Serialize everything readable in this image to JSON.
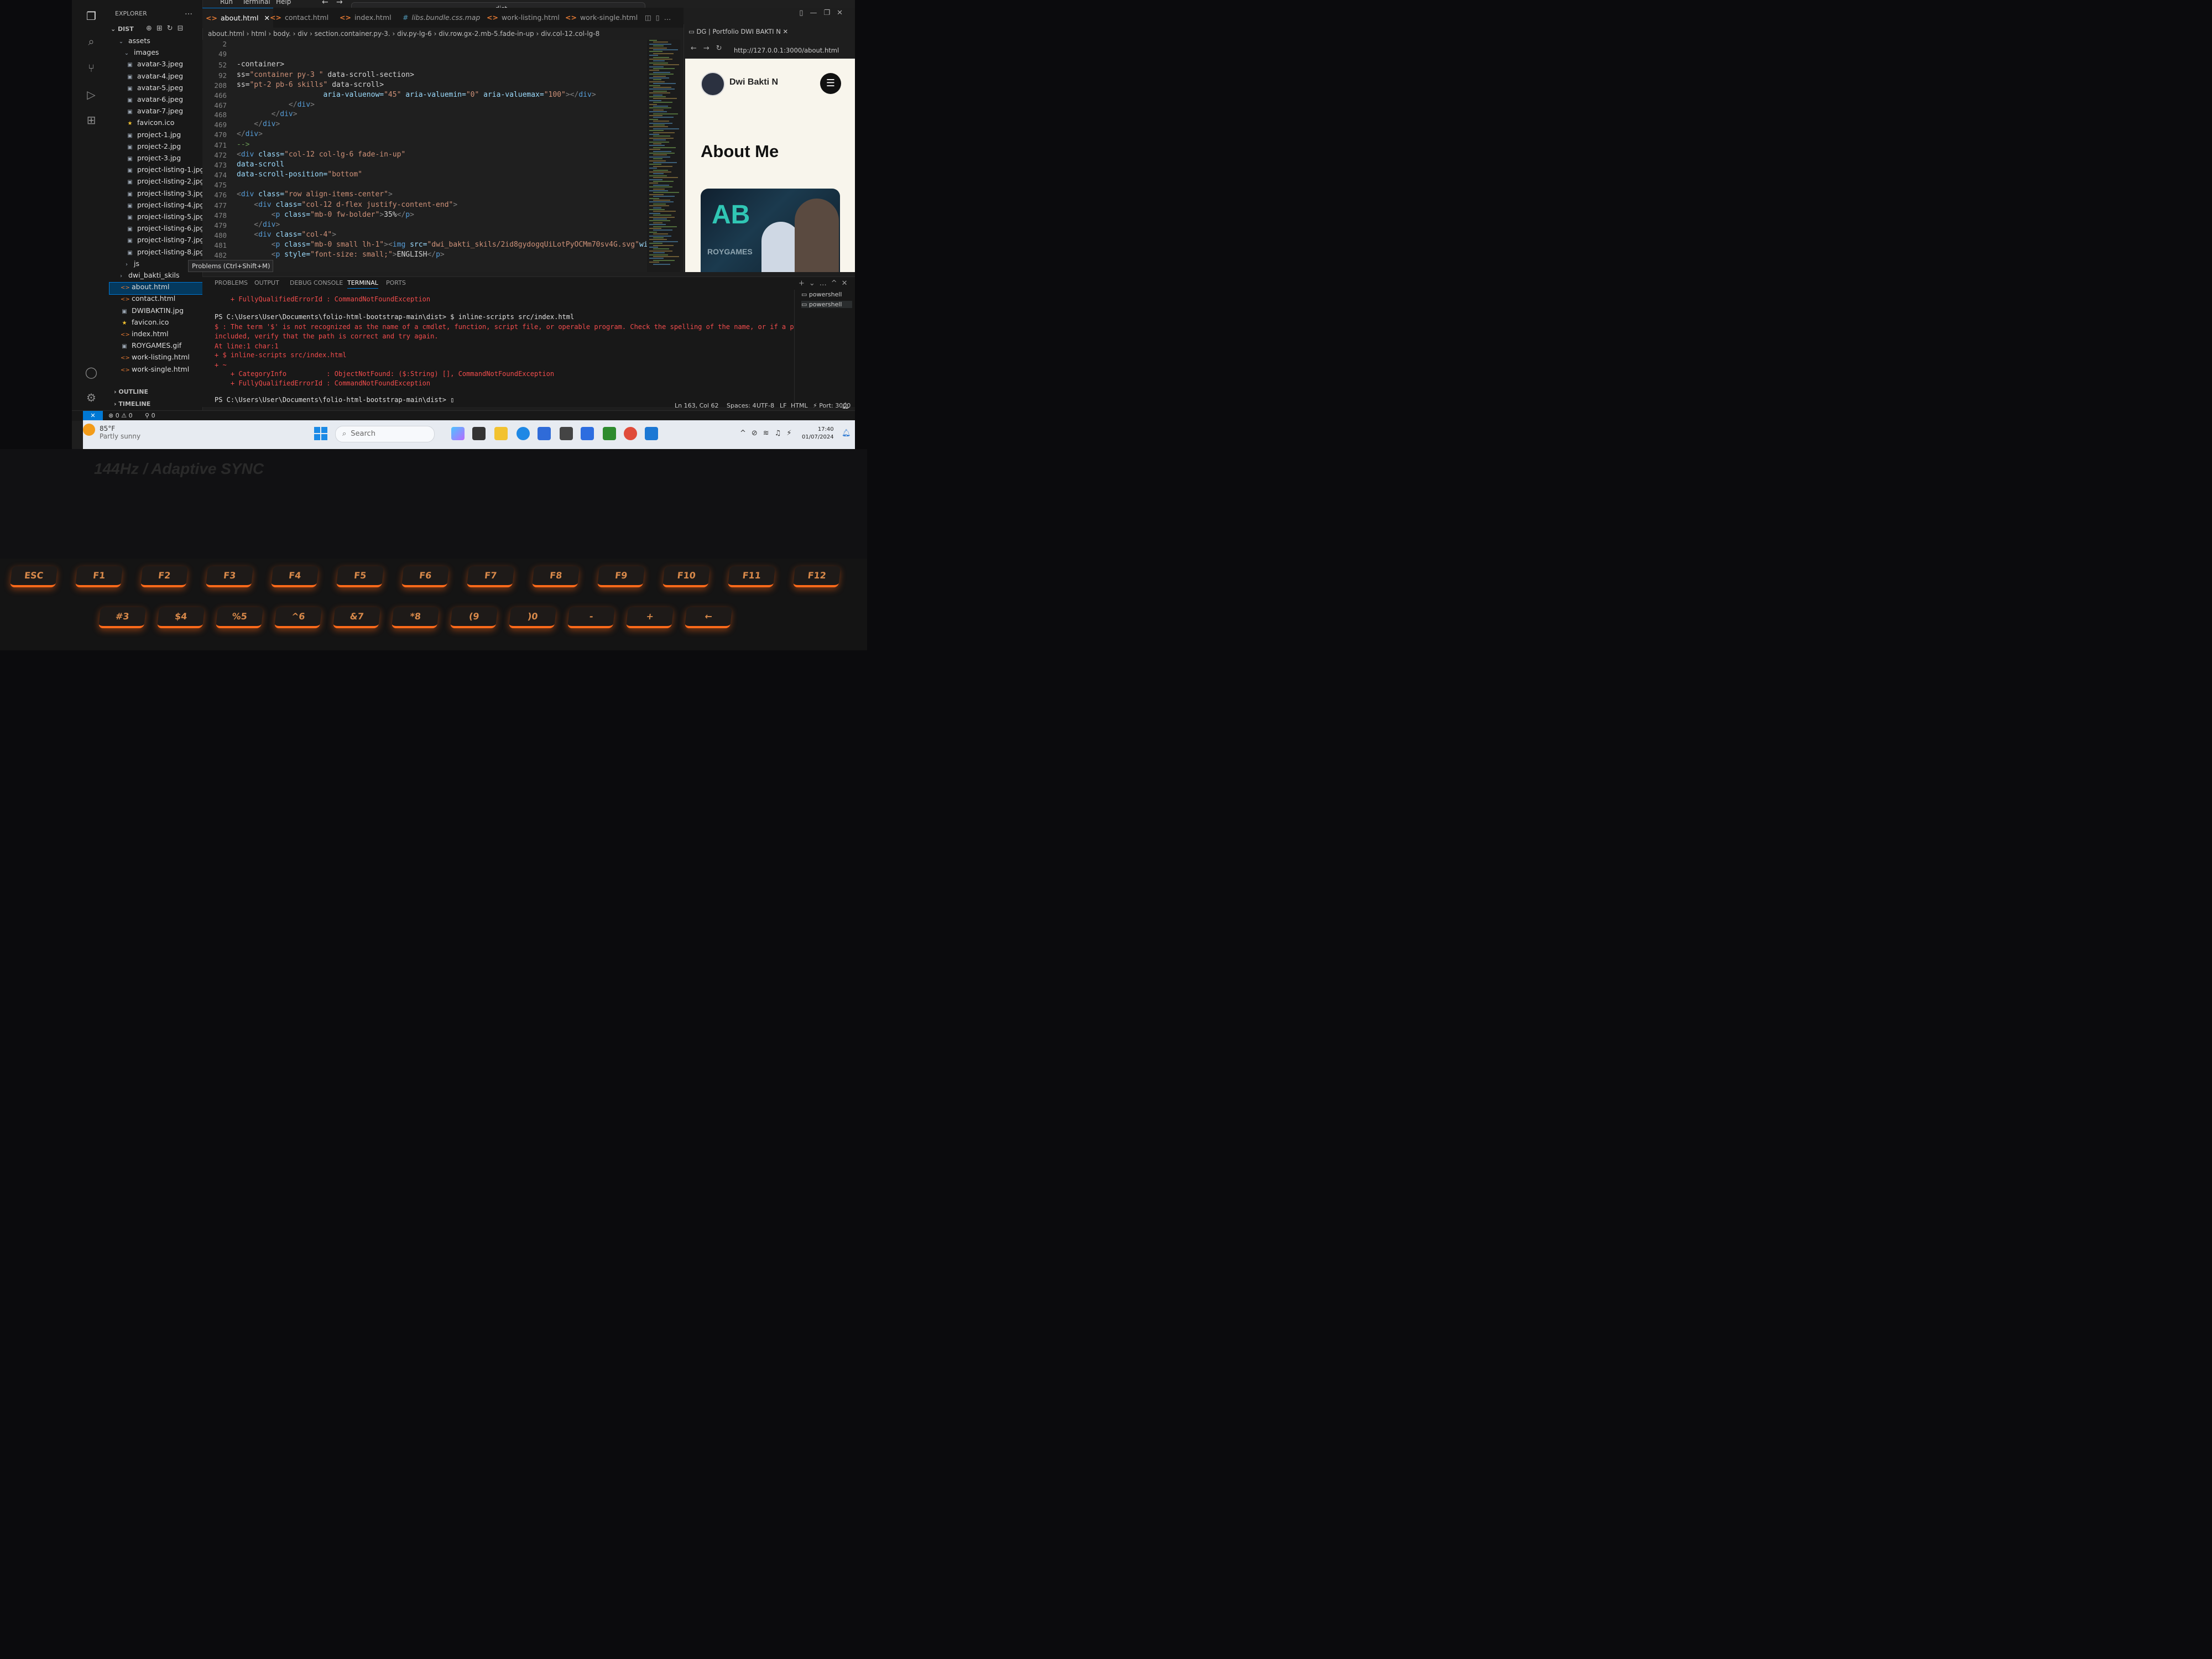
{
  "menu": {
    "items": [
      "Run",
      "Terminal",
      "Help"
    ]
  },
  "command_center": {
    "label": "dist"
  },
  "explorer": {
    "title": "EXPLORER",
    "root": "DIST",
    "items": [
      {
        "label": "assets",
        "kind": "folder-open"
      },
      {
        "label": "images",
        "kind": "folder-open"
      },
      {
        "label": "avatar-3.jpeg",
        "kind": "image"
      },
      {
        "label": "avatar-4.jpeg",
        "kind": "image"
      },
      {
        "label": "avatar-5.jpeg",
        "kind": "image"
      },
      {
        "label": "avatar-6.jpeg",
        "kind": "image"
      },
      {
        "label": "avatar-7.jpeg",
        "kind": "image"
      },
      {
        "label": "favicon.ico",
        "kind": "star"
      },
      {
        "label": "project-1.jpg",
        "kind": "image"
      },
      {
        "label": "project-2.jpg",
        "kind": "image"
      },
      {
        "label": "project-3.jpg",
        "kind": "image"
      },
      {
        "label": "project-listing-1.jpg",
        "kind": "image"
      },
      {
        "label": "project-listing-2.jpg",
        "kind": "image"
      },
      {
        "label": "project-listing-3.jpg",
        "kind": "image"
      },
      {
        "label": "project-listing-4.jpg",
        "kind": "image"
      },
      {
        "label": "project-listing-5.jpg",
        "kind": "image"
      },
      {
        "label": "project-listing-6.jpg",
        "kind": "image"
      },
      {
        "label": "project-listing-7.jpg",
        "kind": "image"
      },
      {
        "label": "project-listing-8.jpg",
        "kind": "image"
      },
      {
        "label": "js",
        "kind": "folder"
      },
      {
        "label": "dwi_bakti_skils",
        "kind": "folder"
      },
      {
        "label": "about.html",
        "kind": "html",
        "selected": true
      },
      {
        "label": "contact.html",
        "kind": "html"
      },
      {
        "label": "DWIBAKTIN.jpg",
        "kind": "image"
      },
      {
        "label": "favicon.ico",
        "kind": "star"
      },
      {
        "label": "index.html",
        "kind": "html"
      },
      {
        "label": "ROYGAMES.gif",
        "kind": "image"
      },
      {
        "label": "work-listing.html",
        "kind": "html"
      },
      {
        "label": "work-single.html",
        "kind": "html"
      }
    ],
    "outline": "OUTLINE",
    "timeline": "TIMELINE"
  },
  "tabs": [
    {
      "label": "about.html",
      "active": true
    },
    {
      "label": "contact.html"
    },
    {
      "label": "index.html"
    },
    {
      "label": "libs.bundle.css.map"
    },
    {
      "label": "work-listing.html"
    },
    {
      "label": "work-single.html"
    }
  ],
  "breadcrumb": [
    "about.html",
    "html",
    "body.",
    "div",
    "section.container.py-3.",
    "div.py-lg-6",
    "div.row.gx-2.mb-5.fade-in-up",
    "div.col-12.col-lg-8"
  ],
  "editor": {
    "lines": [
      {
        "n": "2",
        "code": []
      },
      {
        "n": "49",
        "code": []
      },
      {
        "n": "52",
        "code": [
          [
            "tx",
            "-container>"
          ]
        ]
      },
      {
        "n": "92",
        "code": [
          [
            "tx",
            "ss="
          ],
          [
            "sv",
            "\"container py-3 \""
          ],
          [
            "tx",
            " data-scroll-section>"
          ]
        ]
      },
      {
        "n": "208",
        "code": [
          [
            "tx",
            "ss="
          ],
          [
            "sv",
            "\"pt-2 pb-6 skills\""
          ],
          [
            "tx",
            " data-scroll>"
          ]
        ]
      },
      {
        "n": "466",
        "code": [
          [
            "at",
            "                    aria-valuenow="
          ],
          [
            "sv",
            "\"45\""
          ],
          [
            "at",
            " aria-valuemin="
          ],
          [
            "sv",
            "\"0\""
          ],
          [
            "at",
            " aria-valuemax="
          ],
          [
            "sv",
            "\"100\""
          ],
          [
            "tg",
            "></"
          ],
          [
            "tn",
            "div"
          ],
          [
            "tg",
            ">"
          ]
        ]
      },
      {
        "n": "467",
        "code": [
          [
            "tg",
            "            </"
          ],
          [
            "tn",
            "div"
          ],
          [
            "tg",
            ">"
          ]
        ]
      },
      {
        "n": "468",
        "code": [
          [
            "tg",
            "        </"
          ],
          [
            "tn",
            "div"
          ],
          [
            "tg",
            ">"
          ]
        ]
      },
      {
        "n": "469",
        "code": [
          [
            "tg",
            "    </"
          ],
          [
            "tn",
            "div"
          ],
          [
            "tg",
            ">"
          ]
        ]
      },
      {
        "n": "470",
        "code": [
          [
            "tg",
            "</"
          ],
          [
            "tn",
            "div"
          ],
          [
            "tg",
            ">"
          ]
        ]
      },
      {
        "n": "471",
        "code": [
          [
            "cm",
            "-->"
          ]
        ]
      },
      {
        "n": "472",
        "code": [
          [
            "tg",
            "<"
          ],
          [
            "tn",
            "div"
          ],
          [
            "at",
            " class="
          ],
          [
            "sv",
            "\"col-12 col-lg-6 fade-in-up\""
          ]
        ]
      },
      {
        "n": "473",
        "code": [
          [
            "at",
            "data-scroll"
          ]
        ]
      },
      {
        "n": "474",
        "code": [
          [
            "at",
            "data-scroll-position="
          ],
          [
            "sv",
            "\"bottom\""
          ]
        ]
      },
      {
        "n": "475",
        "code": []
      },
      {
        "n": "476",
        "code": [
          [
            "tg",
            "<"
          ],
          [
            "tn",
            "div"
          ],
          [
            "at",
            " class="
          ],
          [
            "sv",
            "\"row align-items-center\""
          ],
          [
            "tg",
            ">"
          ]
        ]
      },
      {
        "n": "477",
        "code": [
          [
            "tg",
            "    <"
          ],
          [
            "tn",
            "div"
          ],
          [
            "at",
            " class="
          ],
          [
            "sv",
            "\"col-12 d-flex justify-content-end\""
          ],
          [
            "tg",
            ">"
          ]
        ]
      },
      {
        "n": "478",
        "code": [
          [
            "tg",
            "        <"
          ],
          [
            "tn",
            "p"
          ],
          [
            "at",
            " class="
          ],
          [
            "sv",
            "\"mb-0 fw-bolder\""
          ],
          [
            "tg",
            ">"
          ],
          [
            "tx",
            "35%"
          ],
          [
            "tg",
            "</"
          ],
          [
            "tn",
            "p"
          ],
          [
            "tg",
            ">"
          ]
        ]
      },
      {
        "n": "479",
        "code": [
          [
            "tg",
            "    </"
          ],
          [
            "tn",
            "div"
          ],
          [
            "tg",
            ">"
          ]
        ]
      },
      {
        "n": "480",
        "code": [
          [
            "tg",
            "    <"
          ],
          [
            "tn",
            "div"
          ],
          [
            "at",
            " class="
          ],
          [
            "sv",
            "\"col-4\""
          ],
          [
            "tg",
            ">"
          ]
        ]
      },
      {
        "n": "481",
        "code": [
          [
            "tg",
            "        <"
          ],
          [
            "tn",
            "p"
          ],
          [
            "at",
            " class="
          ],
          [
            "sv",
            "\"mb-0 small lh-1\""
          ],
          [
            "tg",
            "><"
          ],
          [
            "tn",
            "img"
          ],
          [
            "at",
            " src="
          ],
          [
            "sv",
            "\"dwi_bakti_skils/2id8gydogqUiLotPyOCMm70sv4G.svg\""
          ],
          [
            "at",
            "width="
          ],
          [
            "sv",
            "\"50"
          ]
        ]
      },
      {
        "n": "482",
        "code": [
          [
            "tg",
            "        <"
          ],
          [
            "tn",
            "p"
          ],
          [
            "at",
            " style="
          ],
          [
            "sv",
            "\"font-size: small;\""
          ],
          [
            "tg",
            ">"
          ],
          [
            "tx",
            "ENGLISH"
          ],
          [
            "tg",
            "</"
          ],
          [
            "tn",
            "p"
          ],
          [
            "tg",
            ">"
          ]
        ]
      },
      {
        "n": "483",
        "code": [
          [
            "tx",
            "    iv>"
          ]
        ]
      }
    ],
    "tooltip": "Problems (Ctrl+Shift+M)"
  },
  "browser": {
    "tab_title": "DG | Portfolio DWI BAKTI N",
    "url": "http://127.0.0.1:3000/about.html",
    "site_name": "Dwi Bakti N",
    "heading": "About Me",
    "hero_logo": "ROYGAMES"
  },
  "panel": {
    "tabs": [
      "PROBLEMS",
      "OUTPUT",
      "DEBUG CONSOLE",
      "TERMINAL",
      "PORTS"
    ],
    "active": "TERMINAL",
    "terminal_list": [
      "powershell",
      "powershell"
    ],
    "lines": [
      {
        "cls": "red",
        "text": "    + FullyQualifiedErrorId : CommandNotFoundException"
      },
      {
        "cls": "wh",
        "text": ""
      },
      {
        "cls": "wh",
        "text": "PS C:\\Users\\User\\Documents\\folio-html-bootstrap-main\\dist> $ inline-scripts src/index.html"
      },
      {
        "cls": "red",
        "text": "$ : The term '$' is not recognized as the name of a cmdlet, function, script file, or operable program. Check the spelling of the name, or if a path was"
      },
      {
        "cls": "red",
        "text": "included, verify that the path is correct and try again."
      },
      {
        "cls": "red",
        "text": "At line:1 char:1"
      },
      {
        "cls": "red",
        "text": "+ $ inline-scripts src/index.html"
      },
      {
        "cls": "red",
        "text": "+ ~"
      },
      {
        "cls": "red",
        "text": "    + CategoryInfo          : ObjectNotFound: ($:String) [], CommandNotFoundException"
      },
      {
        "cls": "red",
        "text": "    + FullyQualifiedErrorId : CommandNotFoundException"
      },
      {
        "cls": "wh",
        "text": ""
      },
      {
        "cls": "wh",
        "text": "PS C:\\Users\\User\\Documents\\folio-html-bootstrap-main\\dist> ▯"
      }
    ]
  },
  "status": {
    "errors": "0",
    "warnings": "0",
    "ports": "0",
    "position": "Ln 163, Col 62",
    "spaces": "Spaces: 4",
    "encoding": "UTF-8",
    "eol": "LF",
    "language": "HTML",
    "port": "Port: 3000"
  },
  "taskbar": {
    "temp": "85°F",
    "weather": "Partly sunny",
    "search": "Search",
    "time": "17:40",
    "date": "01/07/2024"
  },
  "laptop": {
    "badge": "144Hz / Adaptive SYNC",
    "keys": [
      "ESC",
      "F1",
      "F2",
      "F3",
      "F4",
      "F5",
      "F6",
      "F7",
      "F8",
      "F9",
      "F10",
      "F11",
      "F12",
      "#3",
      "$4",
      "%5",
      "^6",
      "&7",
      "*8",
      "(9",
      ")0",
      "-",
      "+",
      "←"
    ]
  }
}
